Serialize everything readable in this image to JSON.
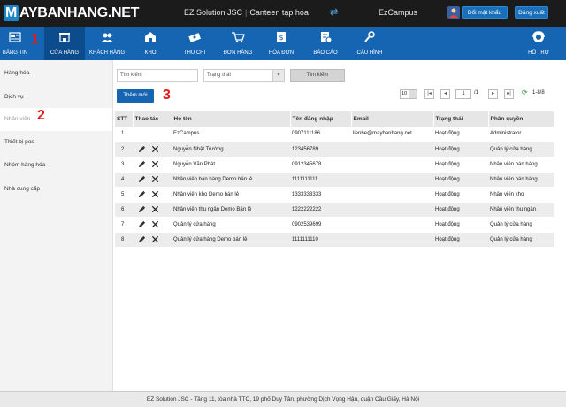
{
  "header": {
    "logo_prefix": "M",
    "logo_rest": "AYBANHANG.NET",
    "company": "EZ Solution JSC",
    "store": "Canteen tạp hóa",
    "username": "EzCampus",
    "change_password": "Đổi mật khẩu",
    "logout": "Đăng xuất"
  },
  "nav": [
    {
      "label": "BẢNG TIN",
      "icon": "newspaper-icon"
    },
    {
      "label": "CỬA HÀNG",
      "icon": "store-icon"
    },
    {
      "label": "KHÁCH HÀNG",
      "icon": "customers-icon"
    },
    {
      "label": "KHO",
      "icon": "warehouse-icon"
    },
    {
      "label": "THU CHI",
      "icon": "money-icon"
    },
    {
      "label": "ĐƠN HÀNG",
      "icon": "cart-icon"
    },
    {
      "label": "HÓA ĐƠN",
      "icon": "invoice-icon"
    },
    {
      "label": "BÁO CÁO",
      "icon": "report-icon"
    },
    {
      "label": "CẤU HÌNH",
      "icon": "settings-icon"
    },
    {
      "label": "HỖ TRỢ",
      "icon": "support-icon"
    }
  ],
  "annotations": {
    "one": "1",
    "two": "2",
    "three": "3"
  },
  "sidebar": [
    "Hàng hóa",
    "Dịch vụ",
    "Nhân viên",
    "Thiết bị pos",
    "Nhóm hàng hóa",
    "Nhà cung cấp"
  ],
  "toolbar": {
    "search_placeholder": "Tìm kiếm",
    "status_placeholder": "Trạng thái",
    "search_button": "Tìm kiếm",
    "add_button": "Thêm mới"
  },
  "pager": {
    "page_size": "10",
    "current_page": "1",
    "total_pages_label": "/1",
    "range": "1-8/8"
  },
  "table": {
    "headers": [
      "STT",
      "Thao tác",
      "Họ tên",
      "Tên đăng nhập",
      "Email",
      "Trạng thái",
      "Phân quyền"
    ],
    "rows": [
      {
        "stt": "1",
        "name": "EzCampus",
        "login": "0907111186",
        "email": "lienhe@maybanhang.net",
        "status": "Hoạt động",
        "role": "Administrator",
        "actions": false
      },
      {
        "stt": "2",
        "name": "Nguyễn Nhật Trường",
        "login": "123456789",
        "email": "",
        "status": "Hoạt động",
        "role": "Quản lý cửa hàng",
        "actions": true
      },
      {
        "stt": "3",
        "name": "Nguyễn Văn Phát",
        "login": "0912345678",
        "email": "",
        "status": "Hoạt động",
        "role": "Nhân viên bán hàng",
        "actions": true
      },
      {
        "stt": "4",
        "name": "Nhân viên bán hàng Demo bán lẻ",
        "login": "1111111111",
        "email": "",
        "status": "Hoạt động",
        "role": "Nhân viên bán hàng",
        "actions": true
      },
      {
        "stt": "5",
        "name": "Nhân viên kho Demo bán lẻ",
        "login": "1333333333",
        "email": "",
        "status": "Hoạt động",
        "role": "Nhân viên kho",
        "actions": true
      },
      {
        "stt": "6",
        "name": "Nhân viên thu ngân Demo Bán lẻ",
        "login": "1222222222",
        "email": "",
        "status": "Hoạt động",
        "role": "Nhân viên thu ngân",
        "actions": true
      },
      {
        "stt": "7",
        "name": "Quản lý cửa hàng",
        "login": "0902539699",
        "email": "",
        "status": "Hoạt động",
        "role": "Quản lý cửa hàng",
        "actions": true
      },
      {
        "stt": "8",
        "name": "Quản lý cửa hàng Demo bán lẻ",
        "login": "1111111110",
        "email": "",
        "status": "Hoạt động",
        "role": "Quản lý cửa hàng",
        "actions": true
      }
    ]
  },
  "footer": "EZ Solution JSC - Tầng 11, tòa nhà TTC, 19 phố Duy Tân, phường Dịch Vọng Hậu, quận Cầu Giấy, Hà Nội",
  "colors": {
    "topbar": "#1b1b1b",
    "nav": "#1665b2",
    "nav_active": "#0d4c8c",
    "annotation": "#e01b1b"
  }
}
